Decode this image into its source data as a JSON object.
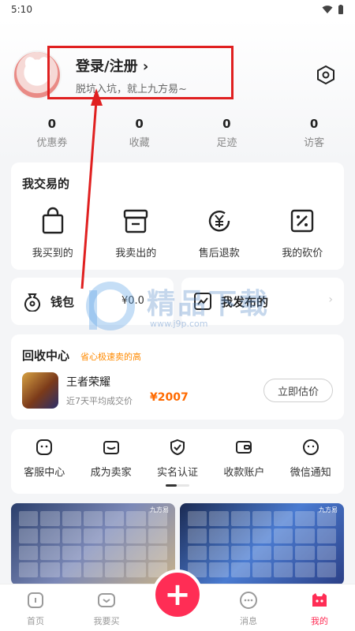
{
  "status": {
    "time": "5:10"
  },
  "profile": {
    "login_label": "登录/注册 ›",
    "subtitle": "脱坑入坑，就上九方易~"
  },
  "stats": [
    {
      "value": "0",
      "label": "优惠券"
    },
    {
      "value": "0",
      "label": "收藏"
    },
    {
      "value": "0",
      "label": "足迹"
    },
    {
      "value": "0",
      "label": "访客"
    }
  ],
  "trade": {
    "title": "我交易的",
    "items": [
      {
        "label": "我买到的",
        "icon": "shopping-bag-icon"
      },
      {
        "label": "我卖出的",
        "icon": "box-icon"
      },
      {
        "label": "售后退款",
        "icon": "yen-refund-icon"
      },
      {
        "label": "我的砍价",
        "icon": "discount-icon"
      }
    ]
  },
  "wallet": {
    "label": "钱包",
    "amount": "¥0.0"
  },
  "my_posts": {
    "label": "我发布的"
  },
  "recycle": {
    "title": "回收中心",
    "tag": "省心极速卖的高",
    "game_name": "王者荣耀",
    "avg_label": "近7天平均成交价",
    "price": "¥2007",
    "button": "立即估价"
  },
  "services": [
    {
      "label": "客服中心",
      "icon": "customer-service-icon"
    },
    {
      "label": "成为卖家",
      "icon": "seller-icon"
    },
    {
      "label": "实名认证",
      "icon": "verify-icon"
    },
    {
      "label": "收款账户",
      "icon": "wallet-card-icon"
    },
    {
      "label": "微信通知",
      "icon": "wechat-icon"
    }
  ],
  "banners": {
    "brand": "九方易"
  },
  "tabbar": [
    {
      "label": "首页",
      "icon": "home-icon"
    },
    {
      "label": "我要买",
      "icon": "gamepad-icon"
    },
    {
      "label": "消息",
      "icon": "message-icon"
    },
    {
      "label": "我的",
      "icon": "profile-icon"
    }
  ],
  "publish": {
    "label": "+"
  },
  "watermark": {
    "text": "精品下载",
    "url": "www.j9p.com"
  },
  "colors": {
    "accent": "#ff2d55",
    "price": "#ff6a00",
    "annotation": "#e02020"
  }
}
